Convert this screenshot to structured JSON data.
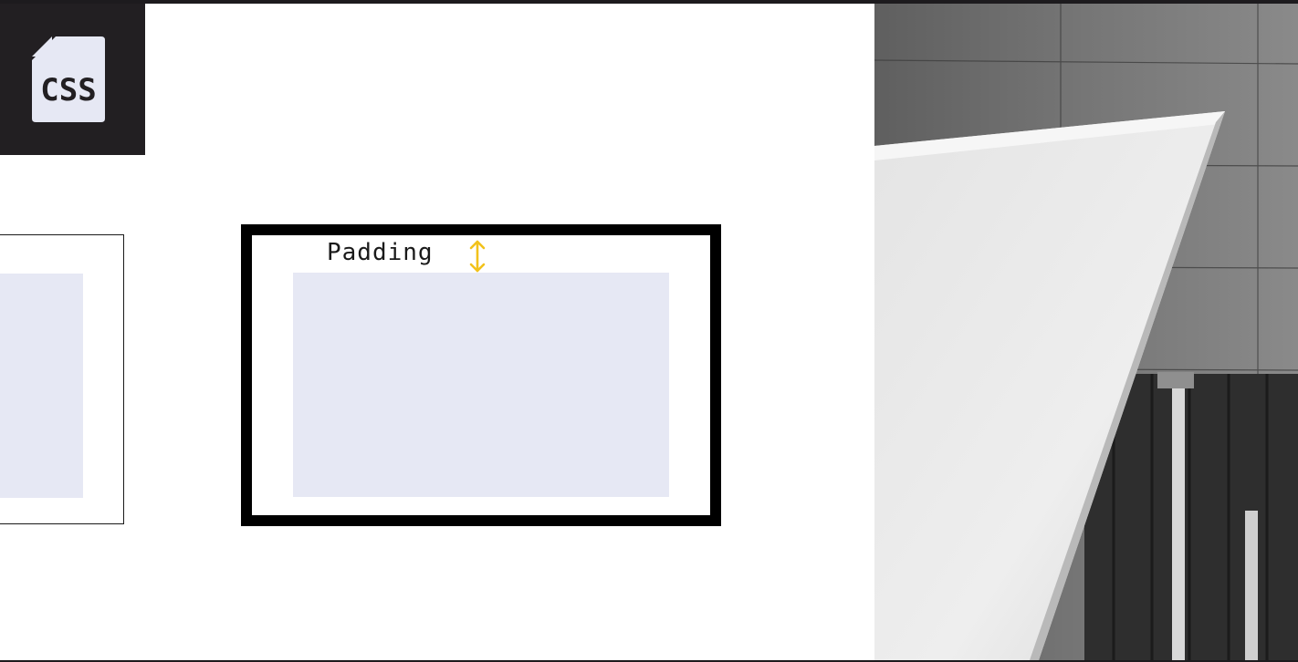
{
  "logo": {
    "text": "CSS",
    "icon": "css-file-icon"
  },
  "diagram": {
    "padding_label": "Padding",
    "padding_arrow_icon": "vertical-double-arrow-icon"
  },
  "photo": {
    "subject": "architecture-photo"
  },
  "colors": {
    "frame_background": "#1d1b1e",
    "slide_background": "#ffffff",
    "logo_tile": "#221f22",
    "logo_file": "#e6e8f4",
    "content_fill": "#e6e8f4",
    "border": "#000000",
    "arrow": "#f2c21b"
  }
}
